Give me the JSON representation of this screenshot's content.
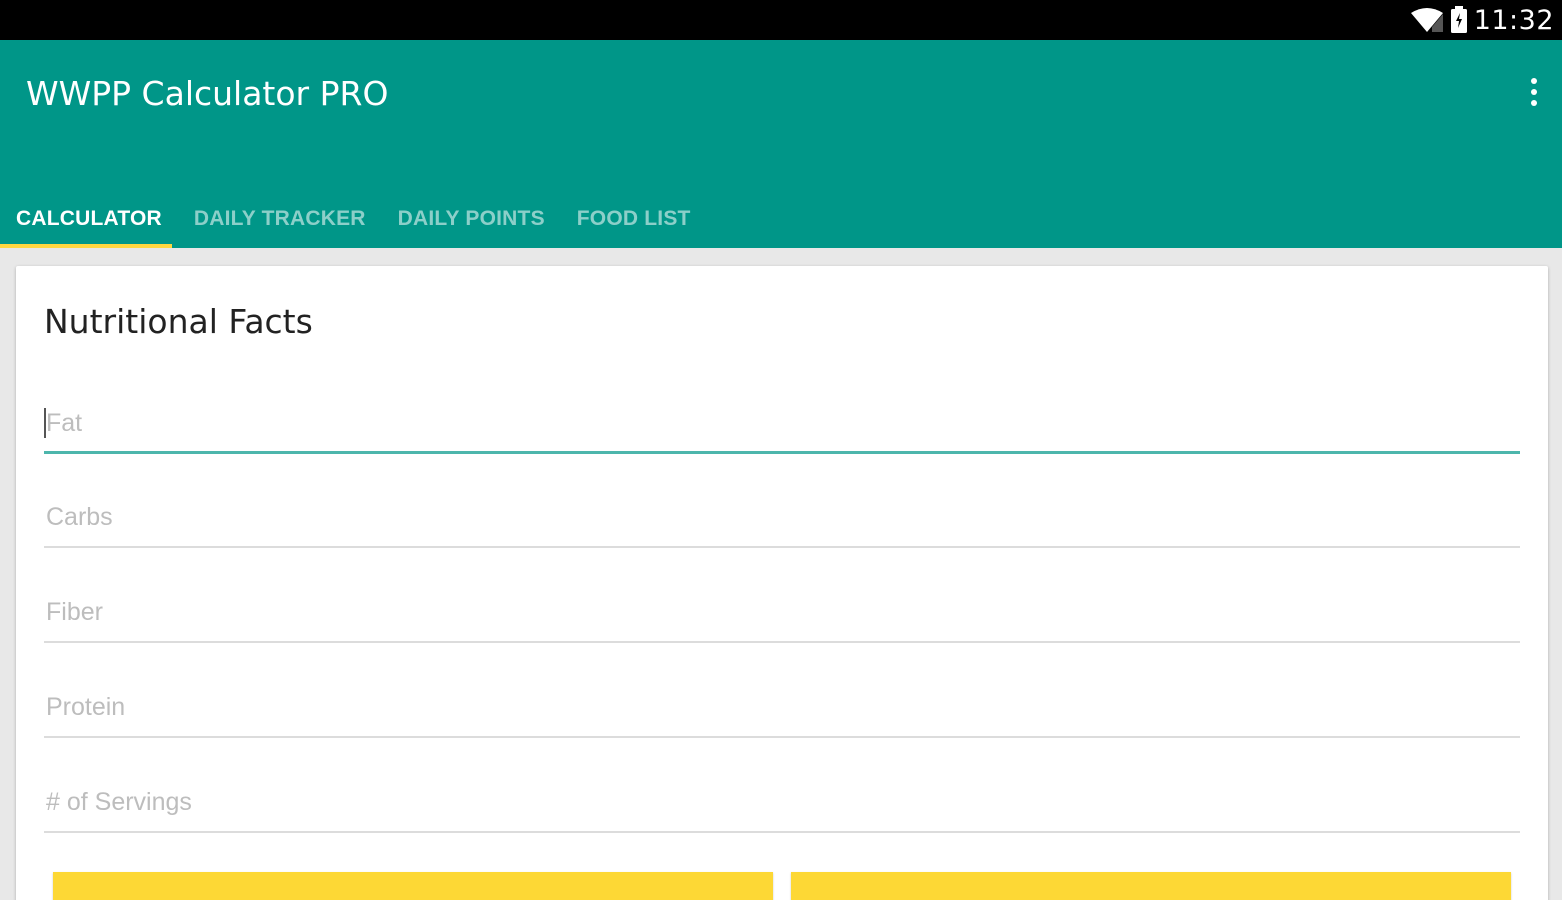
{
  "status_bar": {
    "time": "11:32",
    "icons": [
      "wifi-icon",
      "battery-icon"
    ]
  },
  "app_bar": {
    "title": "WWPP Calculator PRO",
    "menu_icon": "overflow-menu-icon"
  },
  "tabs": [
    {
      "label": "CALCULATOR",
      "active": true
    },
    {
      "label": "DAILY TRACKER",
      "active": false
    },
    {
      "label": "DAILY POINTS",
      "active": false
    },
    {
      "label": "FOOD LIST",
      "active": false
    }
  ],
  "card": {
    "title": "Nutritional Facts",
    "fields": [
      {
        "placeholder": "Fat",
        "value": ""
      },
      {
        "placeholder": "Carbs",
        "value": ""
      },
      {
        "placeholder": "Fiber",
        "value": ""
      },
      {
        "placeholder": "Protein",
        "value": ""
      },
      {
        "placeholder": "# of Servings",
        "value": ""
      }
    ]
  },
  "colors": {
    "primary": "#009688",
    "accent": "#ffd740",
    "focus_line": "#4db6ac",
    "button": "#fdd835"
  }
}
